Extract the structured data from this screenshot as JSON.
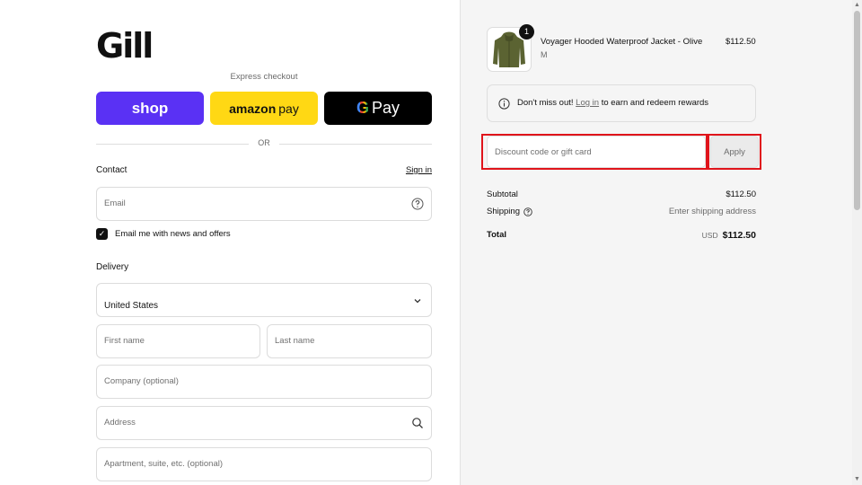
{
  "brand": {
    "logo_text": "Gill"
  },
  "express": {
    "label": "Express checkout",
    "buttons": {
      "shop": "shop",
      "amazon_bold": "amazon",
      "amazon_light": "pay",
      "gpay_g": "G",
      "gpay_text": "Pay"
    },
    "shop_color": "#5a31f4",
    "amazon_color": "#ffd814",
    "gpay_color": "#000000"
  },
  "divider": {
    "text": "OR"
  },
  "contact": {
    "title": "Contact",
    "signin_label": "Sign in",
    "email_placeholder": "Email",
    "marketing_checkbox": {
      "label": "Email me with news and offers",
      "checked": true
    }
  },
  "delivery": {
    "title": "Delivery",
    "country_label": "Country/Region",
    "country_value": "United States",
    "first_name_placeholder": "First name",
    "last_name_placeholder": "Last name",
    "company_placeholder": "Company (optional)",
    "address_placeholder": "Address",
    "apartment_placeholder": "Apartment, suite, etc. (optional)"
  },
  "cart": {
    "item": {
      "name": "Voyager Hooded Waterproof Jacket - Olive",
      "variant": "M",
      "price": "$112.50",
      "quantity": "1",
      "image_icon": "jacket-image"
    },
    "rewards": {
      "prefix": "Don't miss out! ",
      "link": "Log in",
      "suffix": " to earn and redeem rewards"
    },
    "discount": {
      "placeholder": "Discount code or gift card",
      "apply_label": "Apply"
    },
    "highlight_color": "#e0141b",
    "summary": {
      "subtotal_label": "Subtotal",
      "subtotal_value": "$112.50",
      "shipping_label": "Shipping",
      "shipping_value": "Enter shipping address",
      "total_label": "Total",
      "total_currency": "USD",
      "total_value": "$112.50"
    }
  }
}
